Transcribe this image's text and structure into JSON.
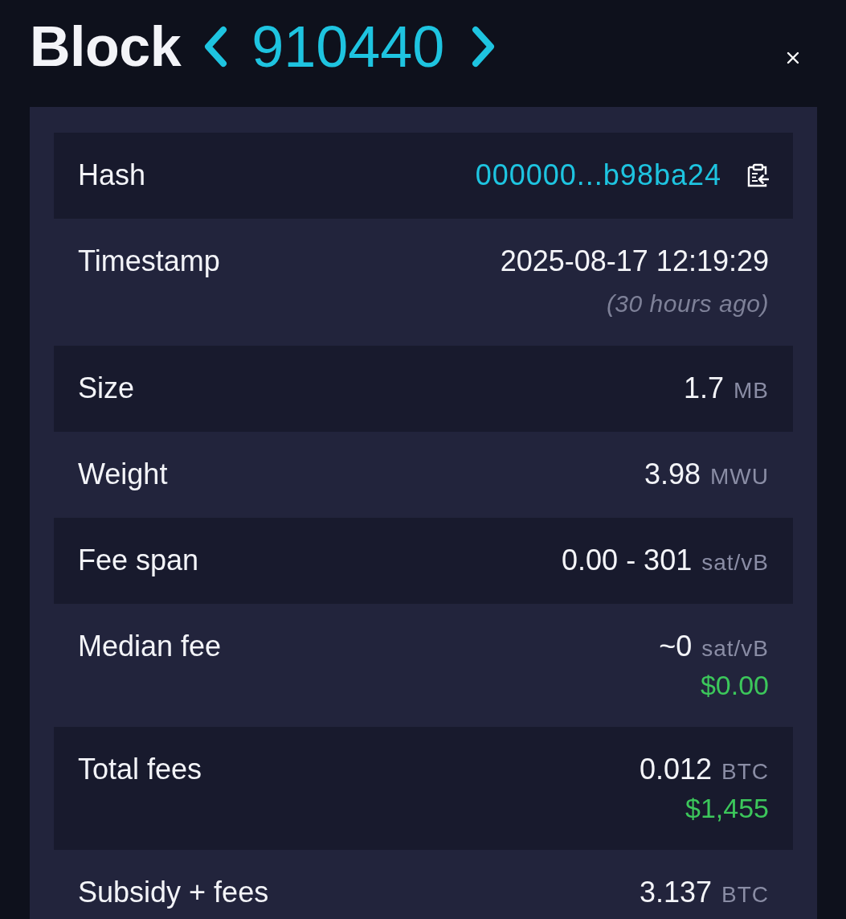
{
  "header": {
    "title": "Block",
    "block_number": "910440"
  },
  "rows": [
    {
      "label": "Hash",
      "kind": "hash",
      "value": "000000...b98ba24"
    },
    {
      "label": "Timestamp",
      "kind": "plain",
      "value": "2025-08-17 12:19:29",
      "note": "(30 hours ago)"
    },
    {
      "label": "Size",
      "kind": "plain",
      "value": "1.7",
      "unit": "MB"
    },
    {
      "label": "Weight",
      "kind": "plain",
      "value": "3.98",
      "unit": "MWU"
    },
    {
      "label": "Fee span",
      "kind": "plain",
      "value": "0.00 - 301",
      "unit": "sat/vB"
    },
    {
      "label": "Median fee",
      "kind": "plain",
      "value": "~0",
      "unit": "sat/vB",
      "fiat": "$0.00"
    },
    {
      "label": "Total fees",
      "kind": "plain",
      "value": "0.012",
      "unit": "BTC",
      "fiat": "$1,455"
    },
    {
      "label": "Subsidy + fees",
      "kind": "plain",
      "value": "3.137",
      "unit": "BTC"
    }
  ]
}
